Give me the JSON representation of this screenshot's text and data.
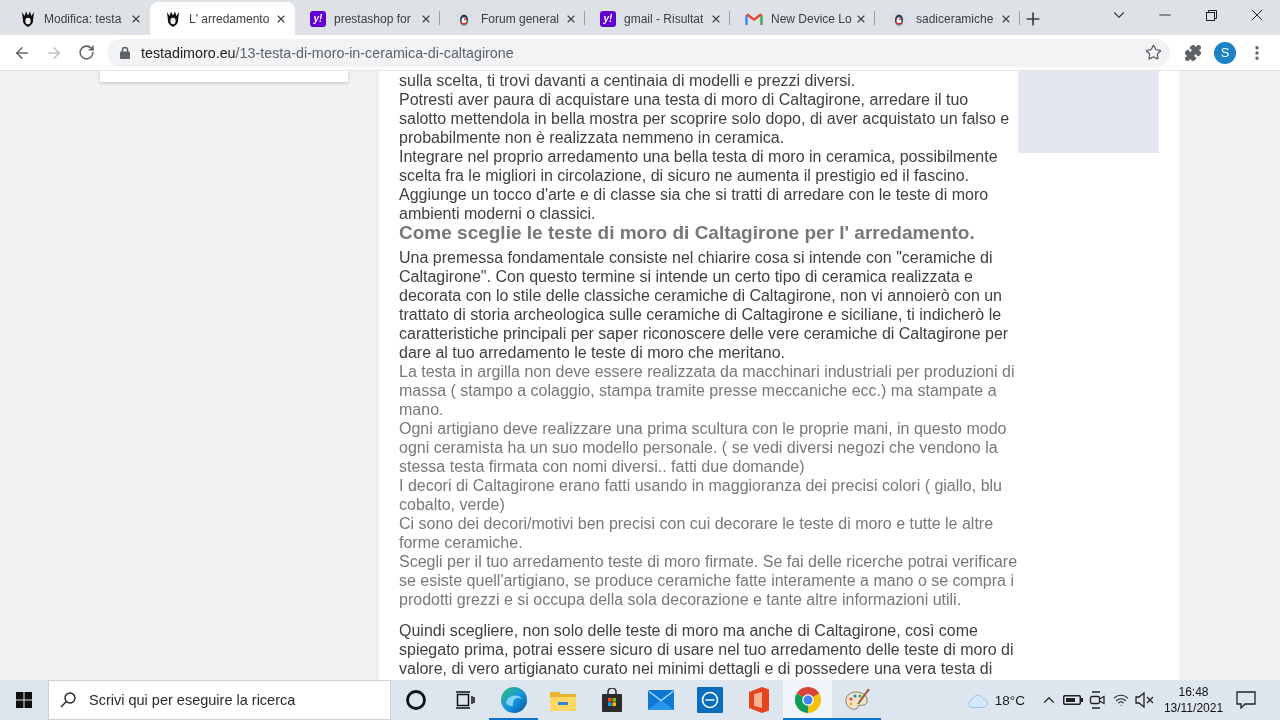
{
  "browser": {
    "tabs": [
      {
        "title": "Modifica: testa",
        "favicon": {
          "kind": "head"
        },
        "selected": false
      },
      {
        "title": "L' arredamento",
        "favicon": {
          "kind": "head"
        },
        "selected": true
      },
      {
        "title": "prestashop for",
        "favicon": {
          "kind": "letters",
          "text": "y!"
        },
        "selected": false
      },
      {
        "title": "Forum general",
        "favicon": {
          "kind": "penguin"
        },
        "selected": false
      },
      {
        "title": "gmail - Risultat",
        "favicon": {
          "kind": "letters",
          "text": "y!"
        },
        "selected": false
      },
      {
        "title": "New Device Lo",
        "favicon": {
          "kind": "mail"
        },
        "selected": false
      },
      {
        "title": "sadiceramiche",
        "favicon": {
          "kind": "penguin"
        },
        "selected": false
      }
    ],
    "nav": {
      "back_disabled": false,
      "forward_disabled": true
    },
    "address": {
      "host": "testadimoro.eu",
      "path": "/13-testa-di-moro-in-ceramica-di-caltagirone"
    },
    "profile": {
      "initial": "S"
    }
  },
  "article": {
    "blocks": [
      {
        "kind": "paragraph",
        "text": "sulla scelta, ti trovi davanti a centinaia di modelli e prezzi diversi."
      },
      {
        "kind": "paragraph",
        "text": "Potresti aver paura di acquistare una testa di moro di Caltagirone, arredare il tuo salotto mettendola in bella mostra per scoprire solo dopo, di aver acquistato un falso e probabilmente non è realizzata nemmeno in ceramica."
      },
      {
        "kind": "paragraph",
        "text": "Integrare nel proprio arredamento una bella testa di moro in ceramica, possibilmente scelta fra le migliori in circolazione, di sicuro ne aumenta il prestigio ed il fascino."
      },
      {
        "kind": "paragraph",
        "text": "Aggiunge un tocco d'arte e di classe sia che si tratti di arredare con le teste di moro ambienti moderni o classici."
      },
      {
        "kind": "heading",
        "text": "Come sceglie le teste di moro di Caltagirone per l' arredamento."
      },
      {
        "kind": "paragraph",
        "text": "Una premessa fondamentale consiste nel chiarire cosa si intende con \"ceramiche di Caltagirone\". Con questo termine si intende un certo tipo di ceramica realizzata e decorata con lo stile delle classiche ceramiche di Caltagirone, non vi annoierò con un trattato di storia archeologica sulle ceramiche di Caltagirone e siciliane, ti indicherò le caratteristiche principali per saper riconoscere delle vere ceramiche di Caltagirone per dare al tuo arredamento le teste di moro che meritano."
      },
      {
        "kind": "list",
        "items": [
          "La testa in argilla non deve essere realizzata da macchinari industriali per produzioni di massa ( stampo a colaggio, stampa tramite presse meccaniche ecc.) ma stampate a mano.",
          "Ogni artigiano deve realizzare una prima scultura con le proprie mani, in questo modo ogni ceramista ha un suo modello personale. ( se vedi diversi negozi che vendono la stessa testa firmata con nomi diversi.. fatti due domande)",
          "I decori di Caltagirone erano fatti usando in maggioranza dei precisi colori ( giallo, blu cobalto, verde)",
          "Ci sono dei decori/motivi ben precisi con cui decorare le teste di moro e tutte le altre forme ceramiche.",
          "Scegli per il tuo arredamento teste di moro firmate. Se fai delle ricerche potrai verificare se esiste quell'artigiano, se produce ceramiche fatte interamente a mano o se compra i prodotti grezzi e si occupa della sola decorazione e tante altre informazioni utili."
        ]
      },
      {
        "kind": "paragraph",
        "text": "Quindi scegliere, non solo delle teste di moro ma anche di Caltagirone, così come spiegato prima, potrai essere sicuro di usare nel tuo arredamento delle teste di moro di valore, di vero artigianato curato nei minimi dettagli e di possedere una vera testa di"
      }
    ]
  },
  "taskbar": {
    "search": {
      "placeholder": "Scrivi qui per eseguire la ricerca"
    },
    "apps": [
      {
        "kind": "cortana",
        "running": false,
        "selected": false
      },
      {
        "kind": "taskview",
        "running": false,
        "selected": false
      },
      {
        "kind": "edge",
        "running": true,
        "selected": false
      },
      {
        "kind": "explorer",
        "running": false,
        "selected": false
      },
      {
        "kind": "store",
        "running": false,
        "selected": false
      },
      {
        "kind": "mail",
        "running": false,
        "selected": false
      },
      {
        "kind": "dell",
        "running": false,
        "selected": false
      },
      {
        "kind": "office",
        "running": false,
        "selected": false
      },
      {
        "kind": "chrome",
        "running": true,
        "selected": true
      },
      {
        "kind": "paint",
        "running": true,
        "selected": false
      }
    ],
    "weather": {
      "temperature": "18°C"
    },
    "tray": {
      "volume_muted": true
    },
    "clock": {
      "time": "16:48",
      "date": "13/11/2021"
    }
  }
}
